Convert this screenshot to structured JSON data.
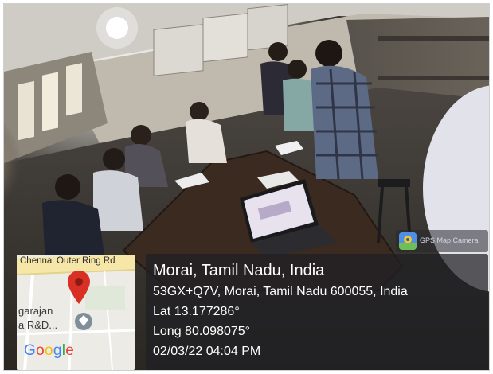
{
  "location": {
    "place": "Morai, Tamil Nadu, India",
    "address": "53GX+Q7V, Morai, Tamil Nadu 600055, India",
    "latitude": "Lat 13.177286°",
    "longitude": "Long 80.098075°",
    "datetime": "02/03/22 04:04 PM"
  },
  "map": {
    "road_label": "Chennai Outer Ring Rd",
    "place_label": "garajan\na R&D...",
    "logo_text": "Google",
    "pin_color": "#d93025"
  },
  "app_badge": {
    "label": "GPS Map Camera",
    "icon": "map-pin-icon"
  }
}
